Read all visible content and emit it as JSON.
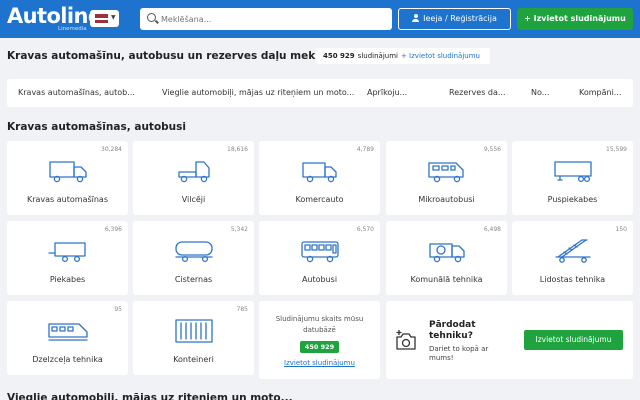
{
  "header": {
    "logo": "Autoline",
    "logo_sub": "Linemedia",
    "search_placeholder": "Meklēšana...",
    "login_label": "Ieeja / Reģistrācija",
    "post_label": "+ Izvietot sludinājumu",
    "colors": {
      "header_bg": "#1e73cf",
      "accent_green": "#1ea33e"
    }
  },
  "title_row": {
    "title": "Kravas automašīnu, autobusu un rezerves daļu meklēšana",
    "count": "450 929",
    "count_label": "sludinājumi",
    "post_link": "+ Izvietot sludinājumu"
  },
  "tabs": [
    {
      "label": "Kravas automašīnas, autob..."
    },
    {
      "label": "Vieglie automobiļi, mājas uz riteņiem un moto..."
    },
    {
      "label": "Aprīkoju..."
    },
    {
      "label": "Rezerves da..."
    },
    {
      "label": "No..."
    },
    {
      "label": "Kompāni..."
    }
  ],
  "section": {
    "title": "Kravas automašīnas, autobusi",
    "next_title": "Vieglie automobiļi, mājas uz riteņiem un moto..."
  },
  "categories": [
    {
      "label": "Kravas automašīnas",
      "count": "30,284",
      "icon": "truck-icon"
    },
    {
      "label": "Vilcēji",
      "count": "18,616",
      "icon": "tractor-unit-icon"
    },
    {
      "label": "Komercauto",
      "count": "4,789",
      "icon": "light-truck-icon"
    },
    {
      "label": "Mikroautobusi",
      "count": "9,556",
      "icon": "minibus-icon"
    },
    {
      "label": "Puspiekabes",
      "count": "15,599",
      "icon": "semi-trailer-icon"
    },
    {
      "label": "Piekabes",
      "count": "6,396",
      "icon": "trailer-icon"
    },
    {
      "label": "Cisternas",
      "count": "5,342",
      "icon": "tank-icon"
    },
    {
      "label": "Autobusi",
      "count": "6,570",
      "icon": "bus-icon"
    },
    {
      "label": "Komunālā tehnika",
      "count": "6,498",
      "icon": "municipal-truck-icon"
    },
    {
      "label": "Lidostas tehnika",
      "count": "150",
      "icon": "airport-stairs-icon"
    },
    {
      "label": "Dzelzceļa tehnika",
      "count": "95",
      "icon": "train-icon"
    },
    {
      "label": "Konteineri",
      "count": "785",
      "icon": "container-icon"
    }
  ],
  "stats": {
    "text": "Sludinājumu skaits mūsu datubāzē",
    "value": "450 929",
    "link": "Izvietot sludinājumu"
  },
  "sell": {
    "title": "Pārdodat tehniku?",
    "subtitle": "Dariet to kopā ar mums!",
    "button": "Izvietot sludinājumu",
    "icon": "camera-plus-icon"
  }
}
